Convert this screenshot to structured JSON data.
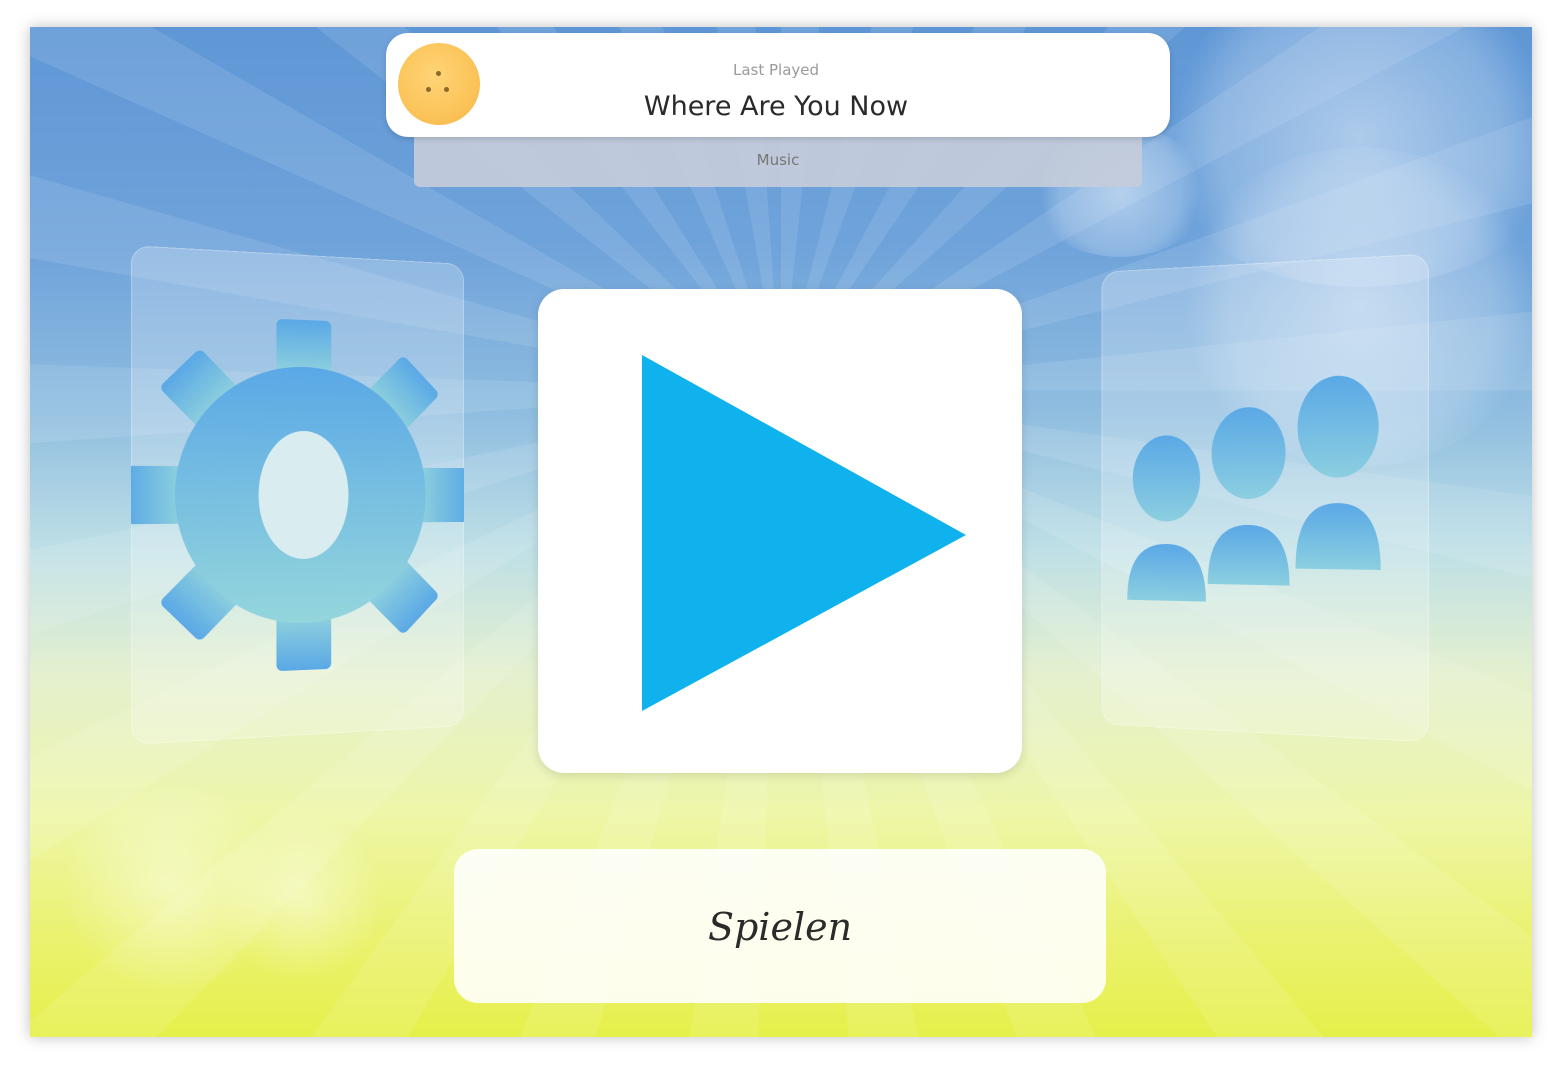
{
  "now_playing": {
    "subtitle": "Last Played",
    "title": "Where Are You Now",
    "bar_label": "Music"
  },
  "tiles": {
    "settings_icon": "gear-icon",
    "play_icon": "play-icon",
    "users_icon": "users-group-icon"
  },
  "main": {
    "label": "Spielen"
  },
  "colors": {
    "play_blue": "#0fb2ec",
    "icon_blue": "#5aaee0",
    "avatar_yellow": "#fbc45a"
  }
}
